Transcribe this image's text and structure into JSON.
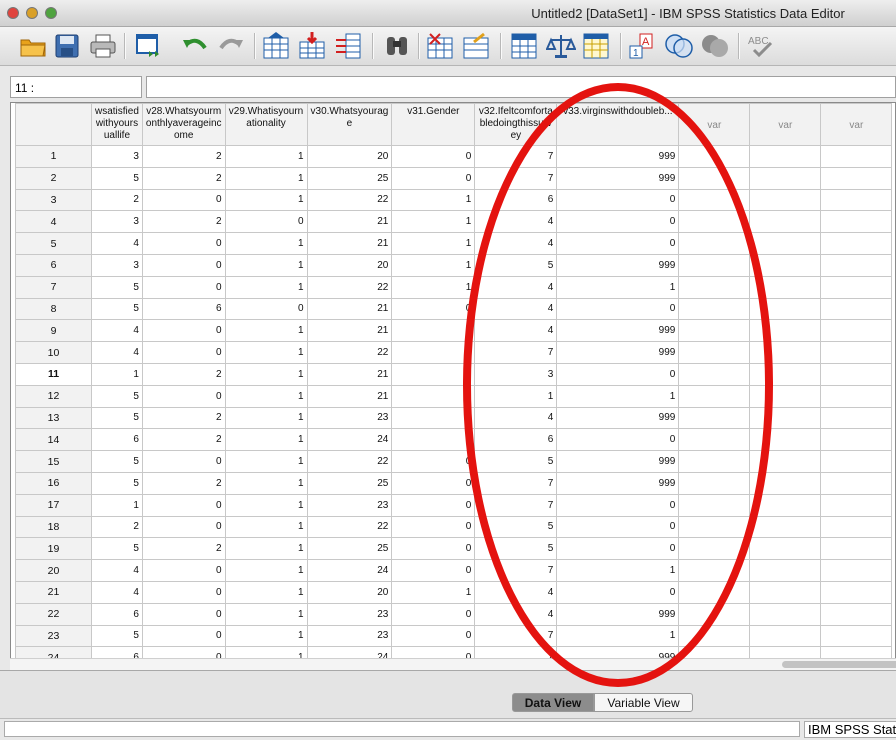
{
  "window": {
    "title": "Untitled2 [DataSet1] - IBM SPSS Statistics Data Editor"
  },
  "toolbar": {
    "icons": [
      "open-folder-icon",
      "save-icon",
      "print-icon",
      "recall-dialog-icon",
      "undo-icon",
      "redo-icon",
      "goto-case-icon",
      "goto-variable-icon",
      "variables-icon",
      "find-icon",
      "insert-cases-icon",
      "insert-variable-icon",
      "split-file-icon",
      "weight-cases-icon",
      "select-cases-icon",
      "value-labels-icon",
      "use-sets-icon",
      "show-all-variables-icon",
      "spell-check-icon"
    ]
  },
  "cell_reference": {
    "label": "11 :",
    "value": ""
  },
  "grid": {
    "columns": [
      "wsatisfied withyours uallife",
      "v28.Whatsyourm onthlyaverageinc ome",
      "v29.Whatisyourn ationality",
      "v30.Whatsyourag e",
      "v31.Gender",
      "v32.Ifeltcomforta bledoingthissurv ey",
      "v33.virginswithdoubleb...",
      "var",
      "var",
      "var"
    ],
    "rows": [
      {
        "n": "1",
        "c": [
          "3",
          "2",
          "1",
          "20",
          "0",
          "7",
          "999"
        ]
      },
      {
        "n": "2",
        "c": [
          "5",
          "2",
          "1",
          "25",
          "0",
          "7",
          "999"
        ]
      },
      {
        "n": "3",
        "c": [
          "2",
          "0",
          "1",
          "22",
          "1",
          "6",
          "0"
        ]
      },
      {
        "n": "4",
        "c": [
          "3",
          "2",
          "0",
          "21",
          "1",
          "4",
          "0"
        ]
      },
      {
        "n": "5",
        "c": [
          "4",
          "0",
          "1",
          "21",
          "1",
          "4",
          "0"
        ]
      },
      {
        "n": "6",
        "c": [
          "3",
          "0",
          "1",
          "20",
          "1",
          "5",
          "999"
        ]
      },
      {
        "n": "7",
        "c": [
          "5",
          "0",
          "1",
          "22",
          "1",
          "4",
          "1"
        ]
      },
      {
        "n": "8",
        "c": [
          "5",
          "6",
          "0",
          "21",
          "0",
          "4",
          "0"
        ]
      },
      {
        "n": "9",
        "c": [
          "4",
          "0",
          "1",
          "21",
          "1",
          "4",
          "999"
        ]
      },
      {
        "n": "10",
        "c": [
          "4",
          "0",
          "1",
          "22",
          "1",
          "7",
          "999"
        ]
      },
      {
        "n": "11",
        "c": [
          "1",
          "2",
          "1",
          "21",
          "1",
          "3",
          "0"
        ]
      },
      {
        "n": "12",
        "c": [
          "5",
          "0",
          "1",
          "21",
          "1",
          "1",
          "1"
        ]
      },
      {
        "n": "13",
        "c": [
          "5",
          "2",
          "1",
          "23",
          "1",
          "4",
          "999"
        ]
      },
      {
        "n": "14",
        "c": [
          "6",
          "2",
          "1",
          "24",
          "1",
          "6",
          "0"
        ]
      },
      {
        "n": "15",
        "c": [
          "5",
          "0",
          "1",
          "22",
          "0",
          "5",
          "999"
        ]
      },
      {
        "n": "16",
        "c": [
          "5",
          "2",
          "1",
          "25",
          "0",
          "7",
          "999"
        ]
      },
      {
        "n": "17",
        "c": [
          "1",
          "0",
          "1",
          "23",
          "0",
          "7",
          "0"
        ]
      },
      {
        "n": "18",
        "c": [
          "2",
          "0",
          "1",
          "22",
          "0",
          "5",
          "0"
        ]
      },
      {
        "n": "19",
        "c": [
          "5",
          "2",
          "1",
          "25",
          "0",
          "5",
          "0"
        ]
      },
      {
        "n": "20",
        "c": [
          "4",
          "0",
          "1",
          "24",
          "0",
          "7",
          "1"
        ]
      },
      {
        "n": "21",
        "c": [
          "4",
          "0",
          "1",
          "20",
          "1",
          "4",
          "0"
        ]
      },
      {
        "n": "22",
        "c": [
          "6",
          "0",
          "1",
          "23",
          "0",
          "4",
          "999"
        ]
      },
      {
        "n": "23",
        "c": [
          "5",
          "0",
          "1",
          "23",
          "0",
          "7",
          "1"
        ]
      },
      {
        "n": "24",
        "c": [
          "6",
          "0",
          "1",
          "24",
          "0",
          "7",
          "999"
        ]
      }
    ]
  },
  "tabs": {
    "data_view": "Data View",
    "variable_view": "Variable View"
  },
  "status": {
    "right": "IBM SPSS Statistics Processor is ready"
  },
  "annotation": {
    "color": "#e4130f"
  }
}
